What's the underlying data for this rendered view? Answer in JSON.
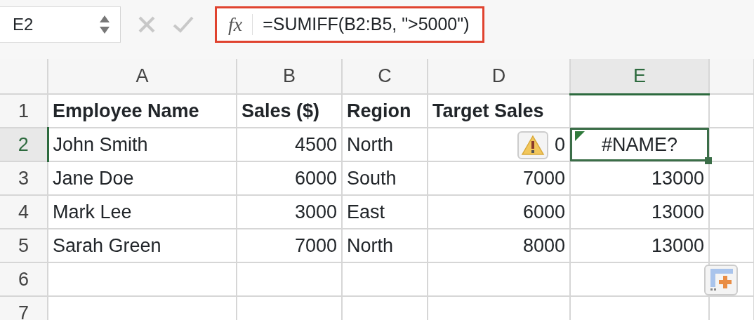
{
  "name_box": {
    "value": "E2"
  },
  "formula_bar": {
    "icon_text": "fx",
    "formula": "=SUMIFF(B2:B5, \">5000\")",
    "highlighted": true
  },
  "columns": [
    {
      "label": "A",
      "selected": false
    },
    {
      "label": "B",
      "selected": false
    },
    {
      "label": "C",
      "selected": false
    },
    {
      "label": "D",
      "selected": false
    },
    {
      "label": "E",
      "selected": true
    }
  ],
  "rows": [
    {
      "label": "1",
      "selected": false,
      "bold": true,
      "cells": [
        {
          "text": "Employee Name",
          "kind": "text"
        },
        {
          "text": "Sales ($)",
          "kind": "text"
        },
        {
          "text": "Region",
          "kind": "text"
        },
        {
          "text": "Target Sales",
          "kind": "text"
        },
        {}
      ]
    },
    {
      "label": "2",
      "selected": true,
      "cells": [
        {
          "text": "John Smith",
          "kind": "text"
        },
        {
          "text": "4500",
          "kind": "number"
        },
        {
          "text": "North",
          "kind": "text"
        },
        {
          "text": "0",
          "kind": "number",
          "warning_button": true
        },
        {
          "text": "#NAME?",
          "kind": "error",
          "selected": true,
          "error_indicator": true
        }
      ]
    },
    {
      "label": "3",
      "selected": false,
      "cells": [
        {
          "text": "Jane Doe",
          "kind": "text"
        },
        {
          "text": "6000",
          "kind": "number"
        },
        {
          "text": "South",
          "kind": "text"
        },
        {
          "text": "7000",
          "kind": "number"
        },
        {
          "text": "13000",
          "kind": "number"
        }
      ]
    },
    {
      "label": "4",
      "selected": false,
      "cells": [
        {
          "text": "Mark Lee",
          "kind": "text"
        },
        {
          "text": "3000",
          "kind": "number"
        },
        {
          "text": "East",
          "kind": "text"
        },
        {
          "text": "6000",
          "kind": "number"
        },
        {
          "text": "13000",
          "kind": "number"
        }
      ]
    },
    {
      "label": "5",
      "selected": false,
      "cells": [
        {
          "text": "Sarah Green",
          "kind": "text"
        },
        {
          "text": "7000",
          "kind": "number"
        },
        {
          "text": "North",
          "kind": "text"
        },
        {
          "text": "8000",
          "kind": "number"
        },
        {
          "text": "13000",
          "kind": "number"
        }
      ]
    },
    {
      "label": "6",
      "selected": false,
      "paste_options_button": true,
      "cells": [
        {},
        {},
        {},
        {},
        {}
      ]
    },
    {
      "label": "7",
      "selected": false,
      "cells": [
        {},
        {},
        {},
        {},
        {}
      ]
    }
  ]
}
